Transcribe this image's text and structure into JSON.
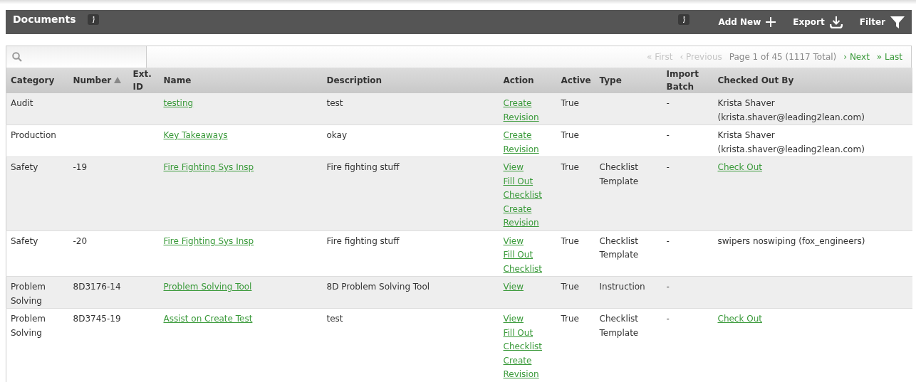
{
  "header": {
    "title": "Documents",
    "actions": [
      {
        "label": "Add New",
        "kind": "add"
      },
      {
        "label": "Export",
        "kind": "export"
      },
      {
        "label": "Filter",
        "kind": "filter"
      }
    ]
  },
  "pagination": {
    "links_before": [
      {
        "label": "« First",
        "disabled": true
      },
      {
        "label": "‹ Previous",
        "disabled": true
      }
    ],
    "summary": "Page 1 of 45 (1117 Total)",
    "links_after": [
      {
        "label": "› Next",
        "disabled": false
      },
      {
        "label": "» Last",
        "disabled": false
      }
    ]
  },
  "table": {
    "columns": [
      {
        "label": "Category",
        "sorted": false
      },
      {
        "label": "Number",
        "sorted": true
      },
      {
        "label": "Ext. ID",
        "sorted": false
      },
      {
        "label": "Name",
        "sorted": false
      },
      {
        "label": "Description",
        "sorted": false
      },
      {
        "label": "Action",
        "sorted": false
      },
      {
        "label": "Active",
        "sorted": false
      },
      {
        "label": "Type",
        "sorted": false
      },
      {
        "label": "Import Batch",
        "sorted": false
      },
      {
        "label": "Checked Out By",
        "sorted": false
      }
    ],
    "rows": [
      {
        "category": "Audit",
        "number": "",
        "name": "testing",
        "description": "test",
        "actions": [
          "Create Revision"
        ],
        "active": "True",
        "type": "",
        "import_batch": "-",
        "checked_out": {
          "kind": "text",
          "text": "Krista Shaver (krista.shaver@leading2lean.com)"
        }
      },
      {
        "category": "Production",
        "number": "",
        "name": "Key Takeaways",
        "description": "okay",
        "actions": [
          "Create Revision"
        ],
        "active": "True",
        "type": "",
        "import_batch": "-",
        "checked_out": {
          "kind": "text",
          "text": "Krista Shaver (krista.shaver@leading2lean.com)"
        }
      },
      {
        "category": "Safety",
        "number": "-19",
        "name": "Fire Fighting Sys Insp",
        "description": "Fire fighting stuff",
        "actions": [
          "View",
          "Fill Out Checklist",
          "Create Revision"
        ],
        "active": "True",
        "type": "Checklist Template",
        "import_batch": "-",
        "checked_out": {
          "kind": "link",
          "text": "Check Out"
        }
      },
      {
        "category": "Safety",
        "number": "-20",
        "name": "Fire Fighting Sys Insp",
        "description": "Fire fighting stuff",
        "actions": [
          "View",
          "Fill Out Checklist"
        ],
        "active": "True",
        "type": "Checklist Template",
        "import_batch": "-",
        "checked_out": {
          "kind": "text",
          "text": "swipers noswiping (fox_engineers)"
        }
      },
      {
        "category": "Problem Solving",
        "number": "8D3176-14",
        "name": "Problem Solving Tool",
        "description": "8D Problem Solving Tool",
        "actions": [
          "View"
        ],
        "active": "True",
        "type": "Instruction",
        "import_batch": "-",
        "checked_out": {
          "kind": "text"
        }
      },
      {
        "category": "Problem Solving",
        "number": "8D3745-19",
        "name": "Assist on Create Test",
        "description": "test",
        "actions": [
          "View",
          "Fill Out Checklist",
          "Create Revision"
        ],
        "active": "True",
        "type": "Checklist Template",
        "import_batch": "-",
        "checked_out": {
          "kind": "link",
          "text": "Check Out"
        }
      }
    ]
  }
}
